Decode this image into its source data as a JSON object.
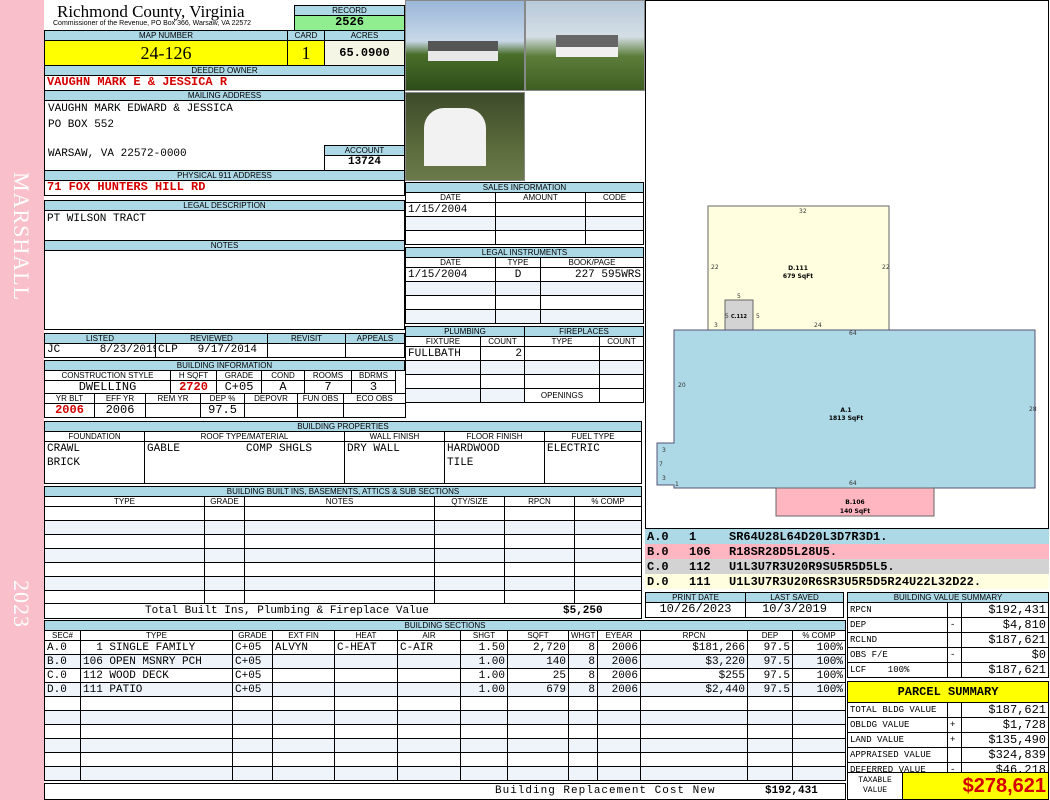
{
  "sidebar": {
    "district": "MARSHALL",
    "year": "2023"
  },
  "header": {
    "county": "Richmond County, Virginia",
    "subtitle": "Commissioner of the Revenue, PO Box 366, Warsaw, VA 22572",
    "record_label": "RECORD",
    "record": "2526",
    "map_label": "MAP NUMBER",
    "map": "24-126",
    "card_label": "CARD",
    "card": "1",
    "acres_label": "ACRES",
    "acres": "65.0900"
  },
  "owner": {
    "label": "DEEDED OWNER",
    "name": "VAUGHN MARK E & JESSICA R"
  },
  "mailing": {
    "label": "MAILING ADDRESS",
    "lines": [
      "VAUGHN MARK EDWARD & JESSICA",
      "PO BOX 552",
      "WARSAW, VA 22572-0000"
    ],
    "account_label": "ACCOUNT",
    "account": "13724"
  },
  "physical": {
    "label": "PHYSICAL 911 ADDRESS",
    "value": "71 FOX HUNTERS HILL RD"
  },
  "legal": {
    "label": "LEGAL DESCRIPTION",
    "value": "PT WILSON TRACT"
  },
  "notes": {
    "label": "NOTES"
  },
  "review": {
    "listed_label": "LISTED",
    "listed": "JC      8/23/2019",
    "reviewed_label": "REVIEWED",
    "reviewed": "CLP   9/17/2014",
    "revisit_label": "REVISIT",
    "appeals_label": "APPEALS"
  },
  "building_info": {
    "label": "BUILDING INFORMATION",
    "headers1": [
      "CONSTRUCTION STYLE",
      "H SQFT",
      "GRADE",
      "COND",
      "ROOMS",
      "BDRMS"
    ],
    "values1": [
      "DWELLING",
      "2720",
      "C+05",
      "A",
      "7",
      "3"
    ],
    "headers2": [
      "YR BLT",
      "EFF YR",
      "REM YR",
      "DEP %",
      "DEPOVR",
      "FUN OBS",
      "ECO OBS"
    ],
    "values2": [
      "2006",
      "2006",
      "",
      "97.5",
      "",
      "",
      ""
    ]
  },
  "properties": {
    "label": "BUILDING PROPERTIES",
    "headers": [
      "FOUNDATION",
      "ROOF TYPE/MATERIAL",
      "WALL FINISH",
      "FLOOR FINISH",
      "FUEL TYPE"
    ],
    "foundation": "CRAWL\nBRICK",
    "roof": "GABLE          COMP SHGLS",
    "wall": "DRY WALL",
    "floor": "HARDWOOD\nTILE",
    "fuel": "ELECTRIC"
  },
  "builtins": {
    "label": "BUILDING BUILT INS, BASEMENTS, ATTICS & SUB SECTIONS",
    "headers": [
      "TYPE",
      "GRADE",
      "NOTES",
      "QTY/SIZE",
      "RPCN",
      "% COMP"
    ],
    "total_label": "Total Built Ins, Plumbing & Fireplace Value",
    "total": "$5,250"
  },
  "sections": {
    "label": "BUILDING SECTIONS",
    "headers": [
      "SEC#",
      "TYPE",
      "GRADE",
      "EXT FIN",
      "HEAT",
      "AIR",
      "SHGT",
      "SQFT",
      "WHGT",
      "EYEAR",
      "RPCN",
      "DEP",
      "% COMP"
    ],
    "rows": [
      [
        "A.0",
        "  1 SINGLE FAMILY",
        "C+05",
        "ALVYN",
        "C-HEAT",
        "C-AIR",
        "1.50",
        "2,720",
        "8",
        "2006",
        "$181,266",
        "97.5",
        "100%"
      ],
      [
        "B.0",
        "106 OPEN MSNRY PCH",
        "C+05",
        "",
        "",
        "",
        "1.00",
        "140",
        "8",
        "2006",
        "$3,220",
        "97.5",
        "100%"
      ],
      [
        "C.0",
        "112 WOOD DECK",
        "C+05",
        "",
        "",
        "",
        "1.00",
        "25",
        "8",
        "2006",
        "$255",
        "97.5",
        "100%"
      ],
      [
        "D.0",
        "111 PATIO",
        "C+05",
        "",
        "",
        "",
        "1.00",
        "679",
        "8",
        "2006",
        "$2,440",
        "97.5",
        "100%"
      ]
    ],
    "total_label": "Building Replacement Cost New",
    "total": "$192,431"
  },
  "sales": {
    "label": "SALES INFORMATION",
    "headers": [
      "DATE",
      "AMOUNT",
      "CODE"
    ],
    "rows": [
      [
        "1/15/2004",
        "",
        ""
      ]
    ]
  },
  "instruments": {
    "label": "LEGAL INSTRUMENTS",
    "headers": [
      "DATE",
      "TYPE",
      "BOOK/PAGE"
    ],
    "rows": [
      [
        "1/15/2004",
        "D",
        "227 595WRS"
      ]
    ]
  },
  "plumbing": {
    "label": "PLUMBING",
    "headers": [
      "FIXTURE",
      "COUNT"
    ],
    "rows": [
      [
        "FULLBATH",
        "2"
      ]
    ]
  },
  "fireplaces": {
    "label": "FIREPLACES",
    "headers": [
      "TYPE",
      "COUNT"
    ],
    "openings_label": "OPENINGS"
  },
  "sketch": {
    "areas": [
      {
        "label": "D.111",
        "sqft": "679 SqFt"
      },
      {
        "label": "C.112",
        "sqft": ""
      },
      {
        "label": "A.1",
        "sqft": "1813 SqFt"
      },
      {
        "label": "B.106",
        "sqft": "140 SqFt"
      }
    ],
    "dims": [
      "32",
      "22",
      "22",
      "5",
      "5",
      "5",
      "3",
      "24",
      "64",
      "20",
      "28",
      "3",
      "7",
      "3",
      "1",
      "64"
    ]
  },
  "sketch_codes": [
    [
      "A.0",
      "1",
      "SR64U28L64D20L3D7R3D1."
    ],
    [
      "B.0",
      "106",
      "R18SR28D5L28U5."
    ],
    [
      "C.0",
      "112",
      "U1L3U7R3U20R9SU5R5D5L5."
    ],
    [
      "D.0",
      "111",
      "U1L3U7R3U20R6SR3U5R5D5R24U22L32D22."
    ]
  ],
  "dates": {
    "print_label": "PRINT DATE",
    "print": "10/26/2023",
    "saved_label": "LAST SAVED",
    "saved": "10/3/2019"
  },
  "value_summary": {
    "label": "BUILDING VALUE SUMMARY",
    "rows": [
      [
        "RPCN",
        "",
        "$192,431"
      ],
      [
        "DEP",
        "-",
        "$4,810"
      ],
      [
        "RCLND",
        "",
        "$187,621"
      ],
      [
        "OBS F/E",
        "-",
        "$0"
      ],
      [
        "LCF    100%",
        "",
        "$187,621"
      ]
    ]
  },
  "parcel": {
    "title": "PARCEL SUMMARY",
    "rows": [
      [
        "TOTAL BLDG VALUE",
        "",
        "$187,621"
      ],
      [
        "OBLDG VALUE",
        "+",
        "$1,728"
      ],
      [
        "LAND VALUE",
        "+",
        "$135,490"
      ],
      [
        "APPRAISED VALUE",
        "",
        "$324,839"
      ],
      [
        "DEFERRED VALUE",
        "-",
        "$46,218"
      ]
    ],
    "taxable_label": "TAXABLE\nVALUE",
    "taxable": "$278,621"
  },
  "colors": {
    "header": "#add8e6",
    "yellow": "#ffff00",
    "green": "#90ee90",
    "red": "#d40000",
    "pink": "#f9c0cb",
    "sketch_a": "#add8e6",
    "sketch_b": "#ffb6c1",
    "sketch_c": "#d3d3d3",
    "sketch_d": "#ffffe0"
  }
}
